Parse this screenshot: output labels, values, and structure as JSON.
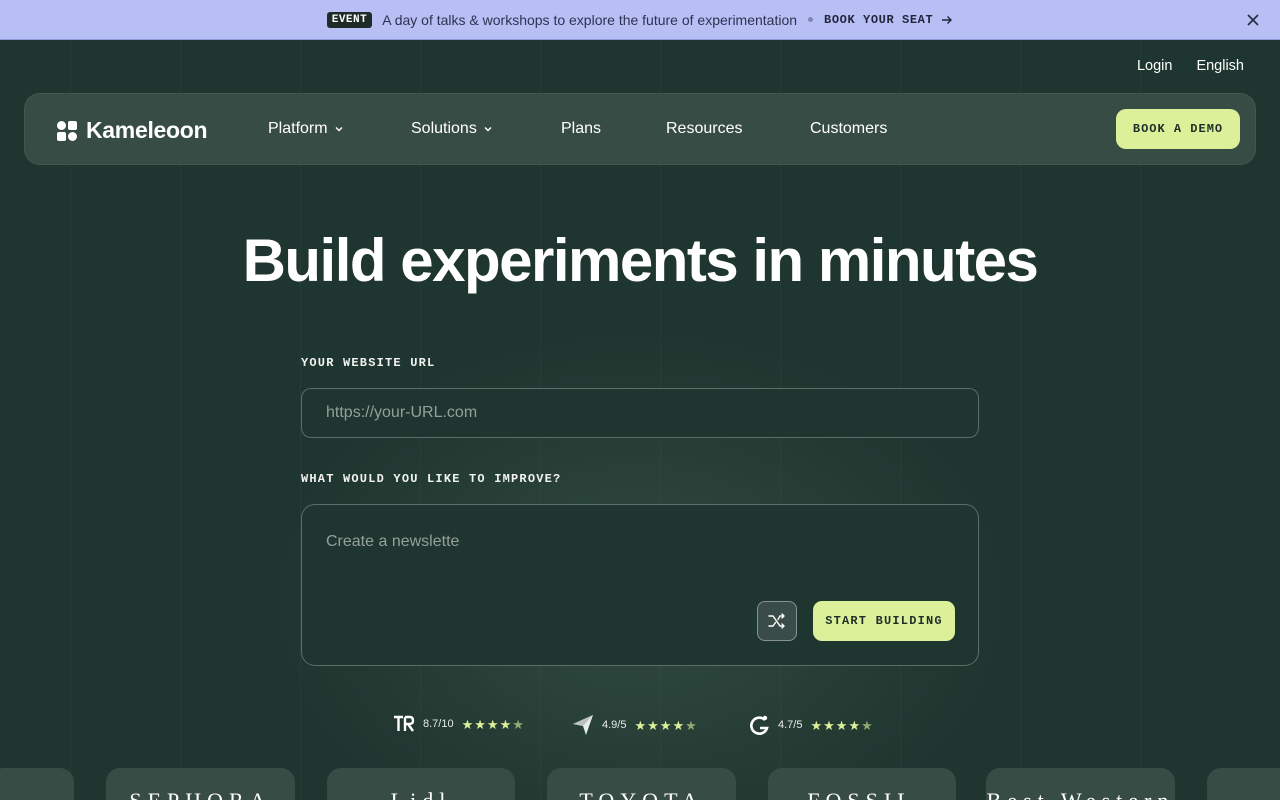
{
  "banner": {
    "badge": "EVENT",
    "text": "A day of talks & workshops to explore the future of experimentation",
    "link_label": "BOOK YOUR SEAT"
  },
  "top_links": {
    "login": "Login",
    "language": "English"
  },
  "nav": {
    "logo": "Kameleoon",
    "items": [
      {
        "label": "Platform",
        "has_dropdown": true
      },
      {
        "label": "Solutions",
        "has_dropdown": true
      },
      {
        "label": "Plans",
        "has_dropdown": false
      },
      {
        "label": "Resources",
        "has_dropdown": false
      },
      {
        "label": "Customers",
        "has_dropdown": false
      }
    ],
    "demo_label": "BOOK A DEMO"
  },
  "hero": {
    "title": "Build experiments in minutes",
    "url_label": "YOUR WEBSITE URL",
    "url_placeholder": "https://your-URL.com",
    "improve_label": "WHAT WOULD YOU LIKE TO IMPROVE?",
    "improve_text": "Create a newslette",
    "start_label": "START BUILDING"
  },
  "ratings": [
    {
      "icon": "trustradius-icon",
      "score": "8.7/10",
      "stars": 4.5
    },
    {
      "icon": "capterra-icon",
      "score": "4.9/5",
      "stars": 4.5
    },
    {
      "icon": "g2-icon",
      "score": "4.7/5",
      "stars": 4.5
    }
  ],
  "customer_logos": [
    "SEPHORA",
    "Lidl",
    "TOYOTA",
    "FOSSIL",
    "Best Western"
  ],
  "colors": {
    "background": "#1f352f",
    "navbar": "#384c46",
    "accent": "#dcf09a",
    "banner": "#b7bff5"
  }
}
